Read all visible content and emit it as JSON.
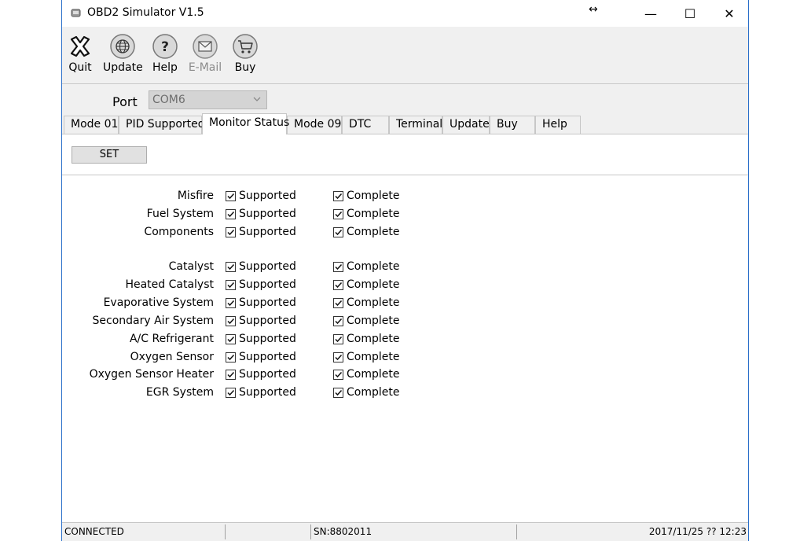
{
  "window": {
    "title": "OBD2 Simulator  V1.5",
    "resize_glyph": "↔",
    "controls": {
      "minimize": "—",
      "maximize": "☐",
      "close": "✕"
    }
  },
  "toolbar": {
    "items": [
      {
        "label": "Quit",
        "icon": "quit-icon",
        "enabled": true
      },
      {
        "label": "Update",
        "icon": "globe-icon",
        "enabled": true
      },
      {
        "label": "Help",
        "icon": "help-icon",
        "enabled": true
      },
      {
        "label": "E-Mail",
        "icon": "mail-icon",
        "enabled": false
      },
      {
        "label": "Buy",
        "icon": "cart-icon",
        "enabled": true
      }
    ]
  },
  "port": {
    "label": "Port",
    "value": "COM6"
  },
  "tabs": [
    {
      "label": "Mode 01"
    },
    {
      "label": "PID Supported"
    },
    {
      "label": "Monitor Status",
      "active": true
    },
    {
      "label": "Mode 09"
    },
    {
      "label": "DTC"
    },
    {
      "label": "Terminal"
    },
    {
      "label": "Update"
    },
    {
      "label": "Buy"
    },
    {
      "label": "Help"
    }
  ],
  "set_button": "SET",
  "monitors": [
    {
      "name": "Misfire",
      "supported_label": "Supported",
      "supported": true,
      "complete_label": "Complete",
      "complete": true
    },
    {
      "name": "Fuel System",
      "supported_label": "Supported",
      "supported": true,
      "complete_label": "Complete",
      "complete": true
    },
    {
      "name": "Components",
      "supported_label": "Supported",
      "supported": true,
      "complete_label": "Complete",
      "complete": true
    },
    {
      "name": "Catalyst",
      "supported_label": "Supported",
      "supported": true,
      "complete_label": "Complete",
      "complete": true
    },
    {
      "name": "Heated Catalyst",
      "supported_label": "Supported",
      "supported": true,
      "complete_label": "Complete",
      "complete": true
    },
    {
      "name": "Evaporative System",
      "supported_label": "Supported",
      "supported": true,
      "complete_label": "Complete",
      "complete": true
    },
    {
      "name": "Secondary Air System",
      "supported_label": "Supported",
      "supported": true,
      "complete_label": "Complete",
      "complete": true
    },
    {
      "name": "A/C Refrigerant",
      "supported_label": "Supported",
      "supported": true,
      "complete_label": "Complete",
      "complete": true
    },
    {
      "name": "Oxygen Sensor",
      "supported_label": "Supported",
      "supported": true,
      "complete_label": "Complete",
      "complete": true
    },
    {
      "name": "Oxygen Sensor Heater",
      "supported_label": "Supported",
      "supported": true,
      "complete_label": "Complete",
      "complete": true
    },
    {
      "name": "EGR System",
      "supported_label": "Supported",
      "supported": true,
      "complete_label": "Complete",
      "complete": true
    }
  ],
  "statusbar": {
    "status": "CONNECTED",
    "empty": "",
    "serial": "SN:8802011",
    "datetime": "2017/11/25 ?? 12:23"
  }
}
